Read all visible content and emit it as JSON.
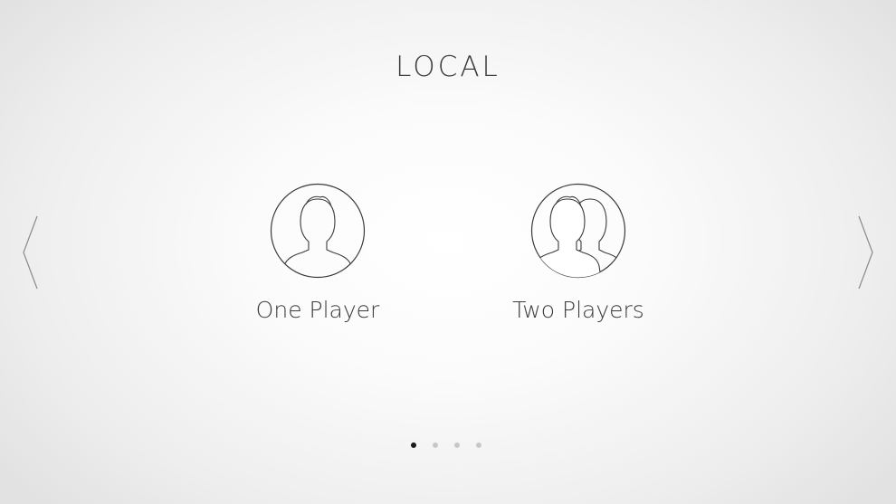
{
  "title": "LOCAL",
  "navigation": {
    "previous_icon": "chevron-left-icon",
    "next_icon": "chevron-right-icon"
  },
  "modes": [
    {
      "label": "One Player",
      "icon": "single-user-icon"
    },
    {
      "label": "Two Players",
      "icon": "two-users-icon"
    }
  ],
  "pagination": {
    "total_pages": 4,
    "current_page": 1
  },
  "colors": {
    "text": "#3c3c3c",
    "dot_active": "#1a1a1a",
    "dot_inactive": "#c8c8c8"
  }
}
